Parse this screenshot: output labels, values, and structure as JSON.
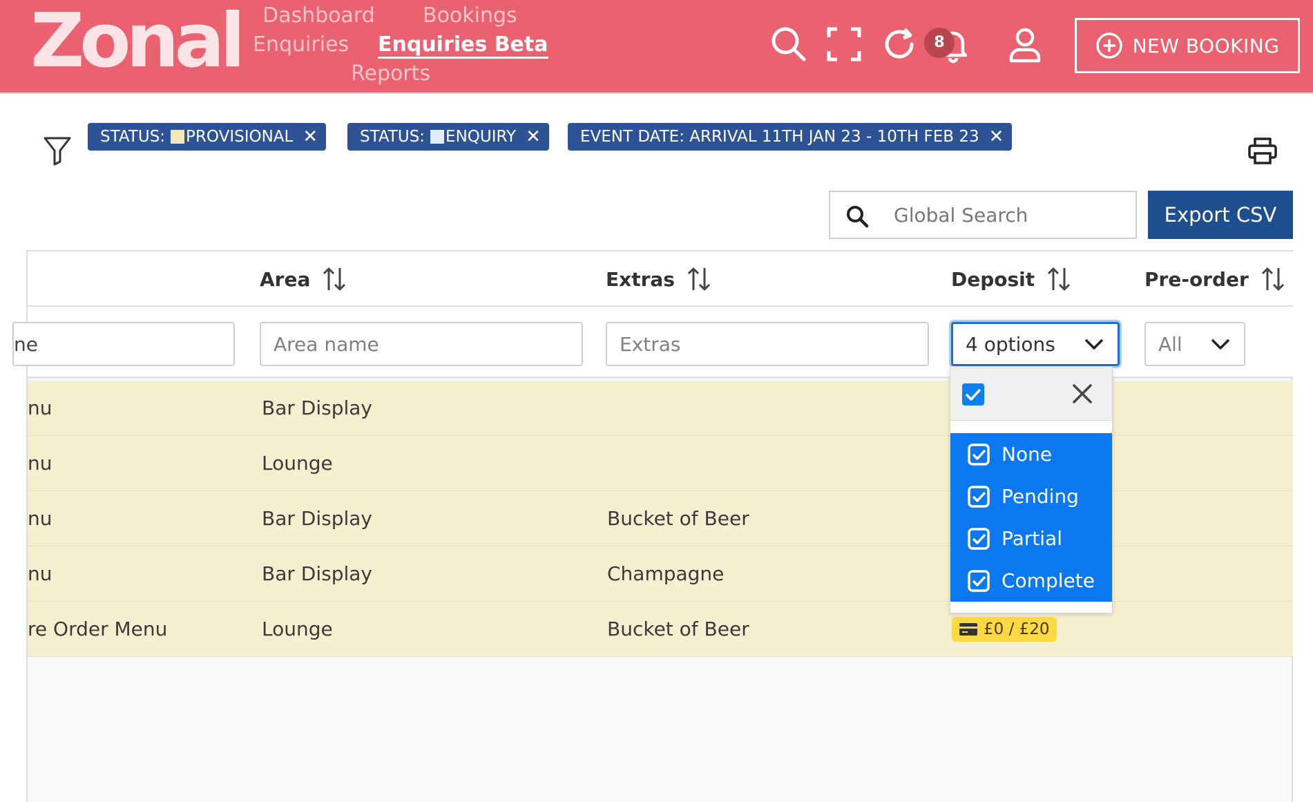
{
  "header": {
    "logo": "Zonal",
    "nav": {
      "dashboard": "Dashboard",
      "bookings": "Bookings",
      "enquiries": "Enquiries",
      "enquiries_beta": "Enquiries Beta",
      "reports": "Reports"
    },
    "notification_count": "8",
    "new_booking_label": "NEW BOOKING"
  },
  "filters": {
    "chips": [
      {
        "label": "STATUS: ",
        "value": "PROVISIONAL",
        "swatch": "#f5e7b8"
      },
      {
        "label": "STATUS: ",
        "value": "ENQUIRY",
        "swatch": "#e3ecf8"
      },
      {
        "label": "EVENT DATE: ARRIVAL 11TH JAN 23 - 10TH FEB 23",
        "value": ""
      }
    ]
  },
  "search": {
    "placeholder": "Global Search"
  },
  "export_label": "Export CSV",
  "table": {
    "columns": {
      "area": "Area",
      "extras": "Extras",
      "deposit": "Deposit",
      "preorder": "Pre-order"
    },
    "filters": {
      "name_partial": "ne",
      "area_placeholder": "Area name",
      "extras_placeholder": "Extras",
      "deposit_selected": "4 options",
      "preorder_selected": "All"
    },
    "rows": [
      {
        "menu": "nu",
        "area": "Bar Display",
        "extras": "",
        "deposit": ""
      },
      {
        "menu": "nu",
        "area": "Lounge",
        "extras": "",
        "deposit": ""
      },
      {
        "menu": "nu",
        "area": "Bar Display",
        "extras": "Bucket of Beer",
        "deposit": ""
      },
      {
        "menu": "nu",
        "area": "Bar Display",
        "extras": "Champagne",
        "deposit": ""
      },
      {
        "menu": "re Order Menu",
        "area": "Lounge",
        "extras": "Bucket of Beer",
        "deposit": "£0 / £20"
      }
    ]
  },
  "deposit_dropdown": {
    "options": [
      "None",
      "Pending",
      "Partial",
      "Complete"
    ]
  },
  "colors": {
    "header_bg": "#ea6170",
    "chip_bg": "#2d5394",
    "export_bg": "#1f4f8e",
    "row_bg": "#f6efcf",
    "dropdown_selected": "#0b78f0",
    "deposit_badge": "#fbd943"
  }
}
